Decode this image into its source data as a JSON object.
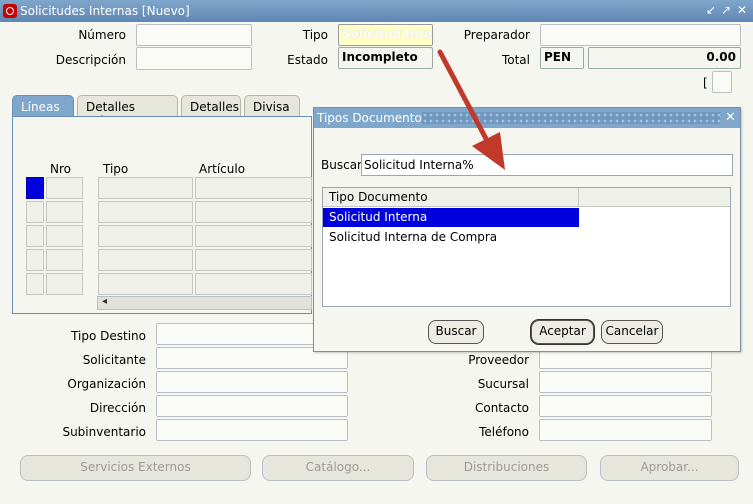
{
  "window": {
    "title": "Solicitudes Internas [Nuevo]",
    "controls": [
      "↙",
      "↗",
      "✕"
    ]
  },
  "header": {
    "numero_label": "Número",
    "numero_value": "",
    "descripcion_label": "Descripción",
    "descripcion_value": "",
    "tipo_label": "Tipo",
    "tipo_value": "Solicitud Interna",
    "estado_label": "Estado",
    "estado_value": "Incompleto",
    "preparador_label": "Preparador",
    "preparador_value": "",
    "total_label": "Total",
    "currency": "PEN",
    "total_value": "0.00",
    "bracket_text": "[    ]"
  },
  "tabs": [
    {
      "label": "Líneas",
      "active": true
    },
    {
      "label": "Detalles Origen",
      "active": false
    },
    {
      "label": "Detalles",
      "active": false
    },
    {
      "label": "Divisa",
      "active": false
    }
  ],
  "lines": {
    "col_nro": "Nro",
    "col_tipo": "Tipo",
    "col_articulo": "Artículo",
    "scroll_left_arrow": "◂"
  },
  "bottom": {
    "tipo_destino_label": "Tipo Destino",
    "solicitante_label": "Solicitante",
    "organizacion_label": "Organización",
    "direccion_label": "Dirección",
    "subinventario_label": "Subinventario",
    "proveedor_label": "Proveedor",
    "sucursal_label": "Sucursal",
    "contacto_label": "Contacto",
    "telefono_label": "Teléfono"
  },
  "buttons": {
    "servicios_externos": "Servicios Externos",
    "catalogo": "Catálogo...",
    "distribuciones": "Distribuciones",
    "aprobar": "Aprobar..."
  },
  "dialog": {
    "title": "Tipos Documento",
    "close": "✕",
    "buscar_label": "Buscar",
    "buscar_value": "Solicitud Interna%",
    "list_header": "Tipo Documento",
    "items": [
      {
        "label": "Solicitud Interna",
        "selected": true
      },
      {
        "label": "Solicitud Interna de Compra",
        "selected": false
      }
    ],
    "btn_buscar": "Buscar",
    "btn_aceptar": "Aceptar",
    "btn_cancelar": "Cancelar"
  },
  "colors": {
    "titlebar": "#7fa6cb",
    "selection": "#0000dd",
    "arrow": "#c0392b"
  }
}
